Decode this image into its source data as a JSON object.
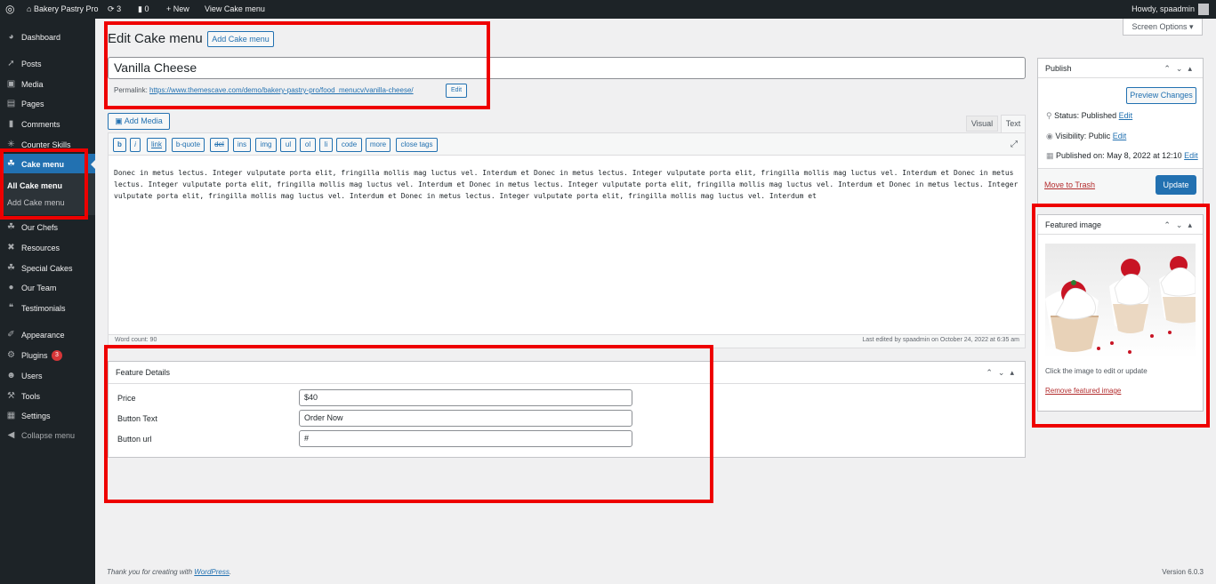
{
  "adminbar": {
    "site_name": "Bakery Pastry Pro",
    "updates_count": "3",
    "comments_count": "0",
    "new_label": "New",
    "view_label": "View Cake menu",
    "howdy": "Howdy, spaadmin"
  },
  "sidebar": {
    "items": [
      {
        "label": "Dashboard",
        "icon": "dashboard-icon"
      },
      {
        "label": "Posts",
        "icon": "pin-icon"
      },
      {
        "label": "Media",
        "icon": "media-icon"
      },
      {
        "label": "Pages",
        "icon": "page-icon"
      },
      {
        "label": "Comments",
        "icon": "comment-icon"
      },
      {
        "label": "Counter Skills",
        "icon": "gear-icon"
      },
      {
        "label": "Cake menu",
        "icon": "cake-icon"
      },
      {
        "label": "Our Chefs",
        "icon": "chef-icon"
      },
      {
        "label": "Resources",
        "icon": "tools-icon"
      },
      {
        "label": "Special Cakes",
        "icon": "cake-icon"
      },
      {
        "label": "Our Team",
        "icon": "team-icon"
      },
      {
        "label": "Testimonials",
        "icon": "quote-icon"
      },
      {
        "label": "Appearance",
        "icon": "brush-icon"
      },
      {
        "label": "Plugins",
        "icon": "plugin-icon",
        "badge": "3"
      },
      {
        "label": "Users",
        "icon": "user-icon"
      },
      {
        "label": "Tools",
        "icon": "wrench-icon"
      },
      {
        "label": "Settings",
        "icon": "settings-icon"
      },
      {
        "label": "Collapse menu",
        "icon": "collapse-icon"
      }
    ],
    "submenu": [
      "All Cake menu",
      "Add Cake menu"
    ]
  },
  "page": {
    "heading": "Edit Cake menu",
    "add_new_label": "Add Cake menu",
    "screen_options": "Screen Options",
    "title_value": "Vanilla Cheese",
    "permalink_label": "Permalink:",
    "permalink_url": "https://www.themescave.com/demo/bakery-pastry-pro/food_menucv/vanilla-cheese/",
    "permalink_edit": "Edit"
  },
  "editor": {
    "add_media": "Add Media",
    "tab_visual": "Visual",
    "tab_text": "Text",
    "quicktags": [
      "b",
      "i",
      "link",
      "b-quote",
      "del",
      "ins",
      "img",
      "ul",
      "ol",
      "li",
      "code",
      "more",
      "close tags"
    ],
    "content": "Donec in metus lectus. Integer vulputate porta elit, fringilla mollis mag luctus vel. Interdum et Donec in metus lectus. Integer vulputate porta elit, fringilla mollis mag luctus vel. Interdum et Donec in metus lectus. Integer vulputate porta elit, fringilla mollis mag luctus vel. Interdum et Donec in metus lectus. Integer vulputate porta elit, fringilla mollis mag luctus vel. Interdum et Donec in metus lectus. Integer vulputate porta elit, fringilla mollis mag luctus vel. Interdum et Donec in metus lectus. Integer vulputate porta elit, fringilla mollis mag luctus vel. Interdum et",
    "word_count": "Word count: 90",
    "last_edited": "Last edited by spaadmin on October 24, 2022 at 6:35 am"
  },
  "feature_details": {
    "title": "Feature Details",
    "fields": [
      {
        "label": "Price",
        "value": "$40"
      },
      {
        "label": "Button Text",
        "value": "Order Now"
      },
      {
        "label": "Button url",
        "value": "#"
      }
    ]
  },
  "publish": {
    "title": "Publish",
    "preview": "Preview Changes",
    "status_label": "Status: Published",
    "visibility_label": "Visibility: Public",
    "published_label": "Published on: May 8, 2022 at 12:10",
    "edit": "Edit",
    "trash": "Move to Trash",
    "update": "Update"
  },
  "featured": {
    "title": "Featured image",
    "hint": "Click the image to edit or update",
    "remove": "Remove featured image"
  },
  "footer": {
    "thanks": "Thank you for creating with",
    "wp_link": "WordPress",
    "version": "Version 6.0.3"
  },
  "colors": {
    "admin_dark": "#1d2327",
    "accent_blue": "#2271b1",
    "highlight_red": "#ee0000",
    "page_bg": "#f0f0f1"
  }
}
